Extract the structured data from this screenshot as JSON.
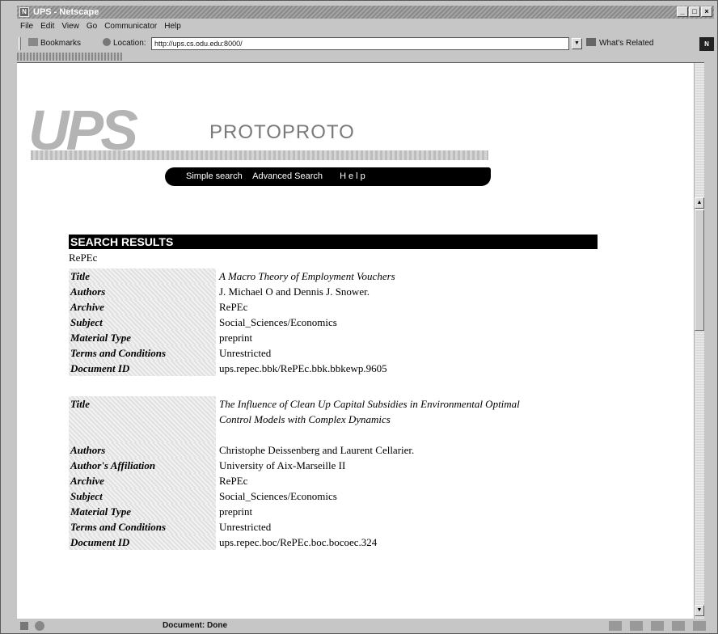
{
  "window": {
    "title": "UPS - Netscape",
    "minimize_glyph": "_",
    "maximize_glyph": "□",
    "close_glyph": "×"
  },
  "menu": [
    "File",
    "Edit",
    "View",
    "Go",
    "Communicator",
    "Help"
  ],
  "toolbar": {
    "bookmarks_label": "Bookmarks",
    "location_label": "Location:",
    "url": "http://ups.cs.odu.edu:8000/",
    "related_label": "What's Related",
    "logo_text": "N"
  },
  "site": {
    "logo_text": "UPS",
    "logo_sub": "PROTOPROTO",
    "nav": [
      "Simple search",
      "Advanced Search",
      "Help"
    ]
  },
  "results": {
    "header": "SEARCH RESULTS",
    "source": "RePEc",
    "records": [
      {
        "Title": "A Macro Theory of Employment Vouchers",
        "Authors": "J. Michael O and Dennis J. Snower.",
        "Archive": "RePEc",
        "Subject": "Social_Sciences/Economics",
        "Material Type": "preprint",
        "Terms and Conditions": "Unrestricted",
        "Document ID": "ups.repec.bbk/RePEc.bbk.bbkewp.9605"
      },
      {
        "Title": "The Influence of Clean Up Capital Subsidies in Environmental Optimal Control Models with Complex Dynamics",
        "Authors": "Christophe Deissenberg and Laurent Cellarier.",
        "Author's Affiliation": "University of Aix-Marseille II",
        "Archive": "RePEc",
        "Subject": "Social_Sciences/Economics",
        "Material Type": "preprint",
        "Terms and Conditions": "Unrestricted",
        "Document ID": "ups.repec.boc/RePEc.boc.bocoec.324"
      }
    ]
  },
  "status": {
    "text": "Document: Done"
  }
}
